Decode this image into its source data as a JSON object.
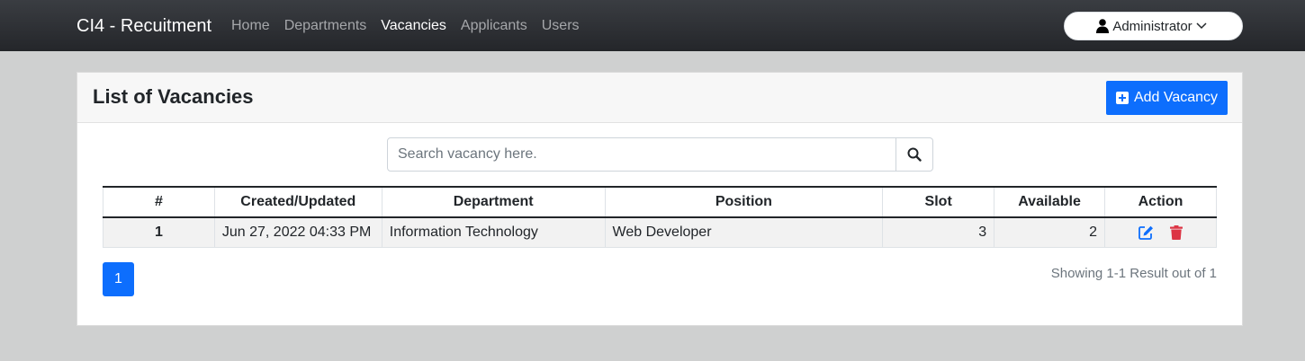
{
  "navbar": {
    "brand": "CI4 - Recuitment",
    "links": [
      {
        "label": "Home",
        "active": false
      },
      {
        "label": "Departments",
        "active": false
      },
      {
        "label": "Vacancies",
        "active": true
      },
      {
        "label": "Applicants",
        "active": false
      },
      {
        "label": "Users",
        "active": false
      }
    ],
    "user": {
      "label": "Administrator",
      "icon": "user-icon",
      "caret": "chevron-down-icon"
    }
  },
  "card": {
    "title": "List of Vacancies",
    "add_button": "Add Vacancy"
  },
  "search": {
    "placeholder": "Search vacancy here.",
    "value": "",
    "icon": "search-icon"
  },
  "table": {
    "headers": [
      "#",
      "Created/Updated",
      "Department",
      "Position",
      "Slot",
      "Available",
      "Action"
    ],
    "rows": [
      {
        "num": "1",
        "created": "Jun 27, 2022 04:33 PM",
        "department": "Information Technology",
        "position": "Web Developer",
        "slot": "3",
        "available": "2"
      }
    ]
  },
  "pagination": {
    "current": "1"
  },
  "showing": "Showing 1-1 Result out of 1",
  "colors": {
    "primary": "#0d6efd",
    "danger": "#dc3545",
    "navbar": "#2b2e33"
  }
}
